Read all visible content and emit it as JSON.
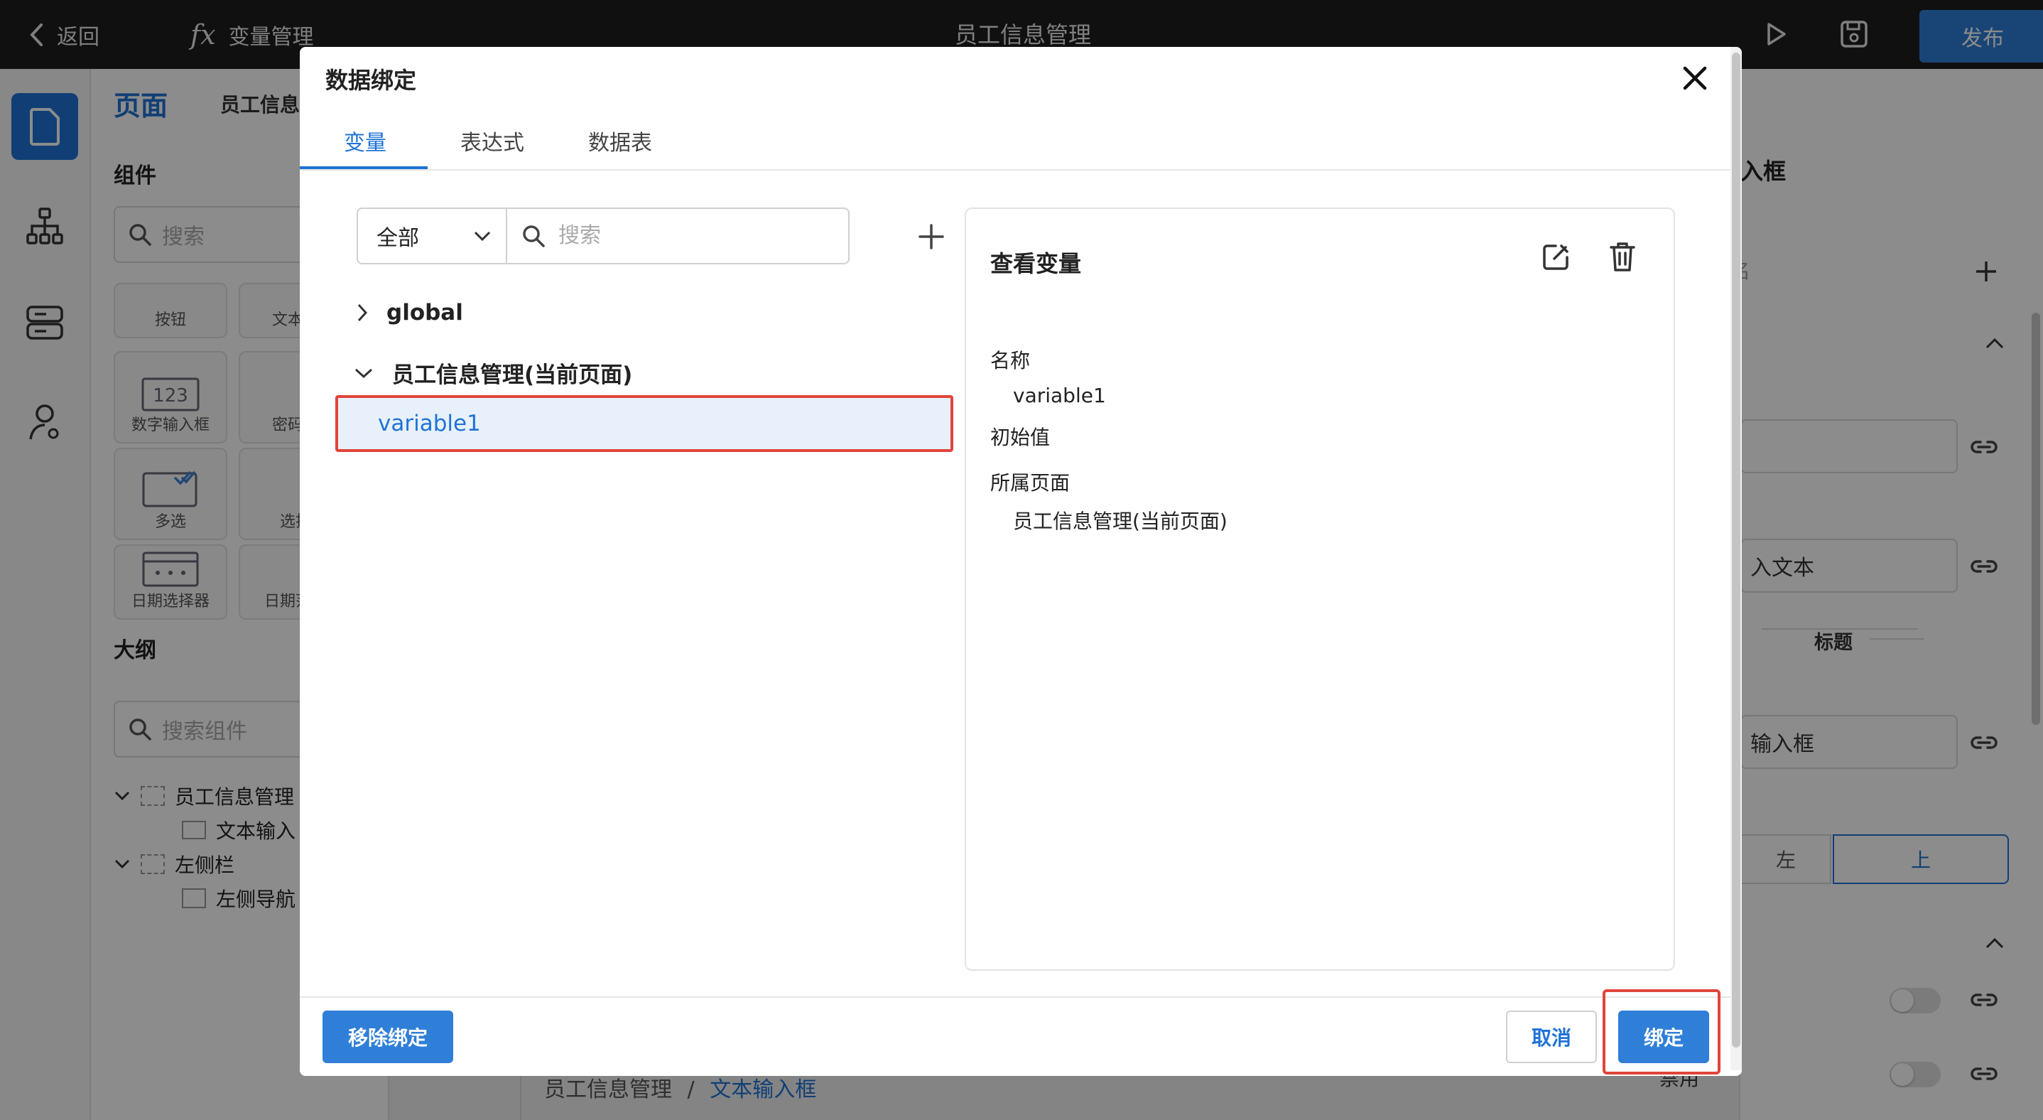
{
  "topbar": {
    "back_label": "返回",
    "fx_glyph": "fx",
    "variables_label": "变量管理",
    "app_title": "员工信息管理",
    "publish_label": "发布"
  },
  "iconrail": {
    "items": [
      {
        "icon": "page-icon",
        "active": true
      },
      {
        "icon": "component-tree-icon"
      },
      {
        "icon": "data-source-icon"
      },
      {
        "icon": "user-icon"
      }
    ]
  },
  "left_panel": {
    "page_tab": "页面",
    "page_sub": "员工信息",
    "components_heading": "组件",
    "search_placeholder": "搜索",
    "tiles": [
      "按钮",
      "文本输",
      "数字输入框",
      "密码输",
      "多选",
      "选择",
      "日期选择器",
      "日期范围"
    ],
    "outline_heading": "大纲",
    "outline_search_placeholder": "搜索组件",
    "outline_tree": [
      "员工信息管理",
      "文本输入",
      "左侧栏",
      "左侧导航"
    ]
  },
  "breadcrumb": {
    "root": "员工信息管理",
    "separator": "/",
    "current": "文本输入框"
  },
  "right_panel": {
    "header_fragment": "入框",
    "field_fragment": "入文本",
    "section_title": "标题",
    "input_fragment": "输入框",
    "align_left": "左",
    "align_top": "上",
    "bottom_fragment": "禁用",
    "mid_fragment": "名"
  },
  "modal": {
    "title": "数据绑定",
    "tabs": [
      "变量",
      "表达式",
      "数据表"
    ],
    "active_tab": 0,
    "scope_select": "全部",
    "search_placeholder": "搜索",
    "tree": {
      "global_label": "global",
      "page_label": "员工信息管理(当前页面)",
      "selected_variable": "variable1"
    },
    "detail": {
      "title": "查看变量",
      "name_label": "名称",
      "name_value": "variable1",
      "initial_label": "初始值",
      "initial_value": "",
      "page_label": "所属页面",
      "page_value": "员工信息管理(当前页面)"
    },
    "footer": {
      "unbind_label": "移除绑定",
      "cancel_label": "取消",
      "bind_label": "绑定"
    }
  },
  "colors": {
    "accent": "#1f73d6",
    "highlight_border": "#e0453a",
    "topbar": "#1e1e1e",
    "selected_row_bg": "#e8f1fb"
  }
}
